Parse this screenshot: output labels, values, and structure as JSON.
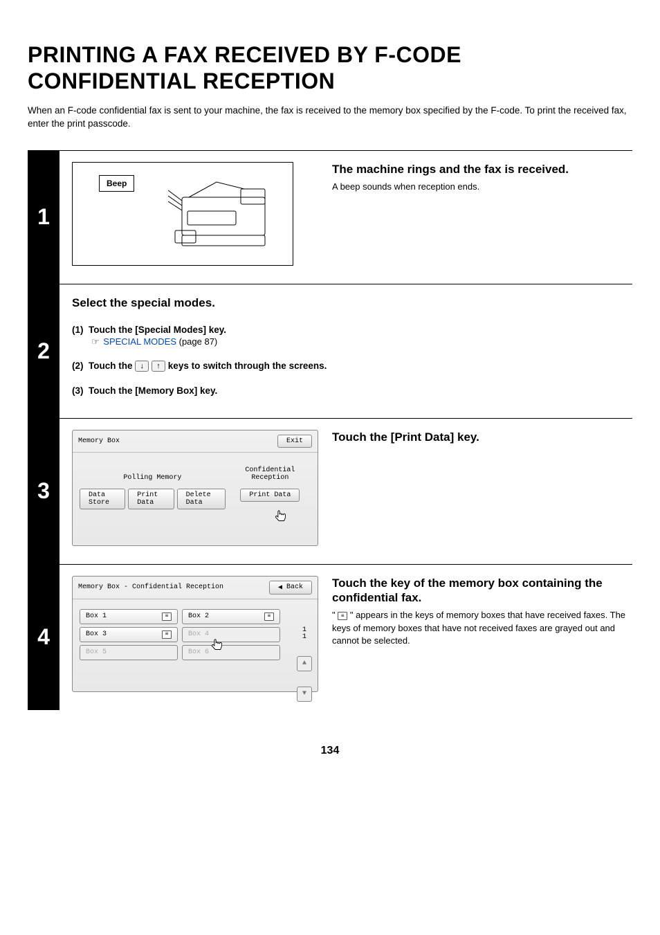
{
  "title_line1": "PRINTING A FAX RECEIVED BY F-CODE",
  "title_line2": "CONFIDENTIAL RECEPTION",
  "intro": "When an F-code confidential fax is sent to your machine, the fax is received to the memory box specified by the F-code. To print the received fax, enter the print passcode.",
  "steps": {
    "s1": {
      "num": "1",
      "beep": "Beep",
      "heading": "The machine rings and the fax is received.",
      "desc": "A beep sounds when reception ends."
    },
    "s2": {
      "num": "2",
      "heading": "Select the special modes.",
      "i1_label": "(1)",
      "i1_text": "Touch the [Special Modes] key.",
      "i1_hand": "☞",
      "i1_link": "SPECIAL MODES",
      "i1_page": " (page 87)",
      "i2_label": "(2)",
      "i2_text_a": "Touch the ",
      "i2_text_b": " keys to switch through the screens.",
      "i2_down": "↓",
      "i2_up": "↑",
      "i3_label": "(3)",
      "i3_text": "Touch the [Memory Box] key."
    },
    "s3": {
      "num": "3",
      "heading": "Touch the [Print Data] key.",
      "panel": {
        "title": "Memory Box",
        "exit": "Exit",
        "left_label": "Polling Memory",
        "right_label_a": "Confidential",
        "right_label_b": "Reception",
        "data_store": "Data Store",
        "print_data_l": "Print Data",
        "delete_data": "Delete Data",
        "print_data_r": "Print Data"
      }
    },
    "s4": {
      "num": "4",
      "heading": "Touch the key of the memory box containing the confidential fax.",
      "desc_a": "\" ",
      "desc_b": " \" appears in the keys of memory boxes that have received faxes. The keys of memory boxes that have not received faxes are grayed out and cannot be selected.",
      "panel": {
        "title": "Memory Box - Confidential Reception",
        "back": "Back",
        "back_arrow": "◀",
        "boxes": [
          "Box 1",
          "Box 2",
          "Box 3",
          "Box 4",
          "Box 5",
          "Box 6"
        ],
        "page_cur": "1",
        "page_tot": "1",
        "up": "▲",
        "down": "▼"
      }
    }
  },
  "page_number": "134"
}
